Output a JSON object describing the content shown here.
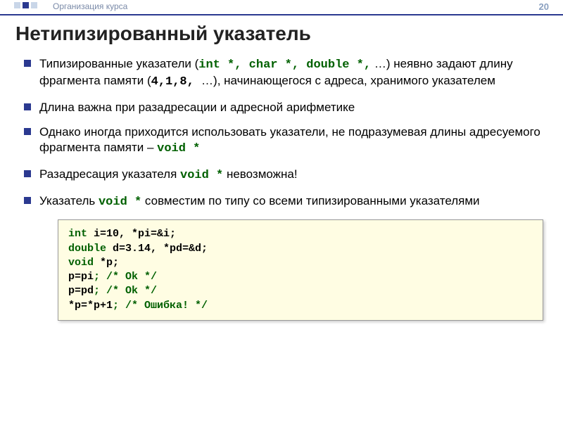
{
  "header": {
    "breadcrumb": "Организация курса",
    "page_number": "20"
  },
  "title": "Нетипизированный указатель",
  "bullets": {
    "b1": {
      "pre": "Типизированные указатели (",
      "types": "int *, char *, double *,",
      "mid1": " …) неявно задают длину фрагмента памяти (",
      "sizes": "4,1,8, ",
      "mid2": "…), начинающегося с адреса, хранимого указателем"
    },
    "b2": "Длина важна при разадресации и адресной арифметике",
    "b3": {
      "pre": "Однако иногда приходится использовать указатели, не подразумевая длины адресуемого фрагмента памяти – ",
      "kw": "void *"
    },
    "b4": {
      "pre": "Разадресация указателя ",
      "kw": "void *",
      "post": " невозможна!"
    },
    "b5": {
      "pre": "Указатель ",
      "kw": "void *",
      "post": " совместим по типу со всеми типизированными указателями"
    }
  },
  "codebox": {
    "l1_kw": "int",
    "l1_rest": " i=10, *pi=&i;",
    "l2_kw": "double",
    "l2_rest": " d=3.14, *pd=&d;",
    "l3_kw": "void",
    "l3_rest": " *p;",
    "l4_a": "p=pi",
    "l4_semi": ";",
    "l4_c": " /* Ok */",
    "l5_a": "p=pd",
    "l5_semi": ";",
    "l5_c": " /* Ok */",
    "l6_a": "*p=*p+1",
    "l6_semi": ";",
    "l6_c": " /* Ошибка! */"
  }
}
